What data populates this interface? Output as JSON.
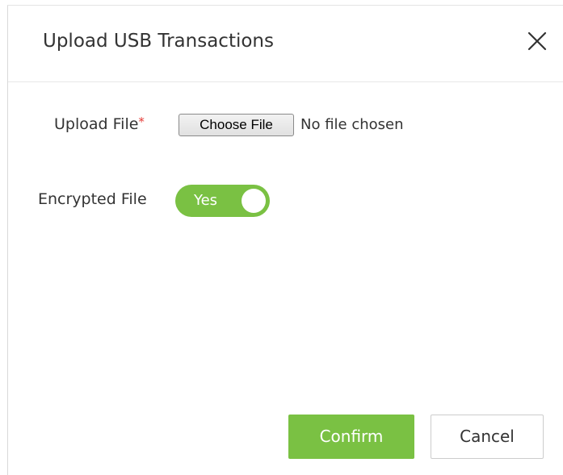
{
  "dialog": {
    "title": "Upload USB Transactions",
    "close_icon": "close-icon"
  },
  "form": {
    "upload_file": {
      "label": "Upload File",
      "required_marker": "*",
      "choose_button_label": "Choose File",
      "status_text": "No file chosen"
    },
    "encrypted_file": {
      "label": "Encrypted File",
      "toggle_text": "Yes",
      "value": true
    }
  },
  "footer": {
    "confirm_label": "Confirm",
    "cancel_label": "Cancel"
  },
  "colors": {
    "accent_green": "#7ac143",
    "required_red": "#e53935",
    "text": "#333333",
    "border": "#cccccc"
  }
}
